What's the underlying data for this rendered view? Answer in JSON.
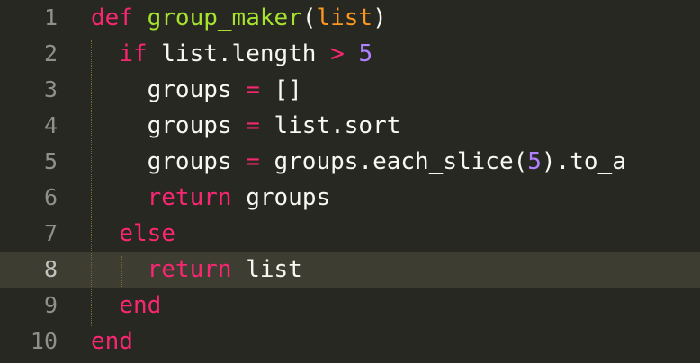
{
  "editor": {
    "active_line": 8,
    "lines": [
      {
        "number": "1",
        "tokens": [
          {
            "type": "kw",
            "text": "def"
          },
          {
            "type": "plain",
            "text": " "
          },
          {
            "type": "fn",
            "text": "group_maker"
          },
          {
            "type": "plain",
            "text": "("
          },
          {
            "type": "param",
            "text": "list"
          },
          {
            "type": "plain",
            "text": ")"
          }
        ]
      },
      {
        "number": "2",
        "tokens": [
          {
            "type": "plain",
            "text": "  "
          },
          {
            "type": "kw",
            "text": "if"
          },
          {
            "type": "plain",
            "text": " list.length "
          },
          {
            "type": "op",
            "text": ">"
          },
          {
            "type": "plain",
            "text": " "
          },
          {
            "type": "num",
            "text": "5"
          }
        ]
      },
      {
        "number": "3",
        "tokens": [
          {
            "type": "plain",
            "text": "    groups "
          },
          {
            "type": "op",
            "text": "="
          },
          {
            "type": "plain",
            "text": " []"
          }
        ]
      },
      {
        "number": "4",
        "tokens": [
          {
            "type": "plain",
            "text": "    groups "
          },
          {
            "type": "op",
            "text": "="
          },
          {
            "type": "plain",
            "text": " list.sort"
          }
        ]
      },
      {
        "number": "5",
        "tokens": [
          {
            "type": "plain",
            "text": "    groups "
          },
          {
            "type": "op",
            "text": "="
          },
          {
            "type": "plain",
            "text": " groups.each_slice("
          },
          {
            "type": "num",
            "text": "5"
          },
          {
            "type": "plain",
            "text": ").to_a"
          }
        ]
      },
      {
        "number": "6",
        "tokens": [
          {
            "type": "plain",
            "text": "    "
          },
          {
            "type": "kw",
            "text": "return"
          },
          {
            "type": "plain",
            "text": " groups"
          }
        ]
      },
      {
        "number": "7",
        "tokens": [
          {
            "type": "plain",
            "text": "  "
          },
          {
            "type": "kw",
            "text": "else"
          }
        ]
      },
      {
        "number": "8",
        "tokens": [
          {
            "type": "plain",
            "text": "    "
          },
          {
            "type": "kw",
            "text": "return"
          },
          {
            "type": "plain",
            "text": " list"
          }
        ]
      },
      {
        "number": "9",
        "tokens": [
          {
            "type": "plain",
            "text": "  "
          },
          {
            "type": "kw",
            "text": "end"
          }
        ]
      },
      {
        "number": "10",
        "tokens": [
          {
            "type": "kw",
            "text": "end"
          }
        ]
      }
    ]
  },
  "colors": {
    "background": "#272822",
    "active_line": "#3e3d32",
    "keyword": "#f92672",
    "function": "#a6e22e",
    "parameter": "#fd971f",
    "number": "#ae81ff",
    "text": "#f8f8f2",
    "line_number": "#8f908a"
  }
}
